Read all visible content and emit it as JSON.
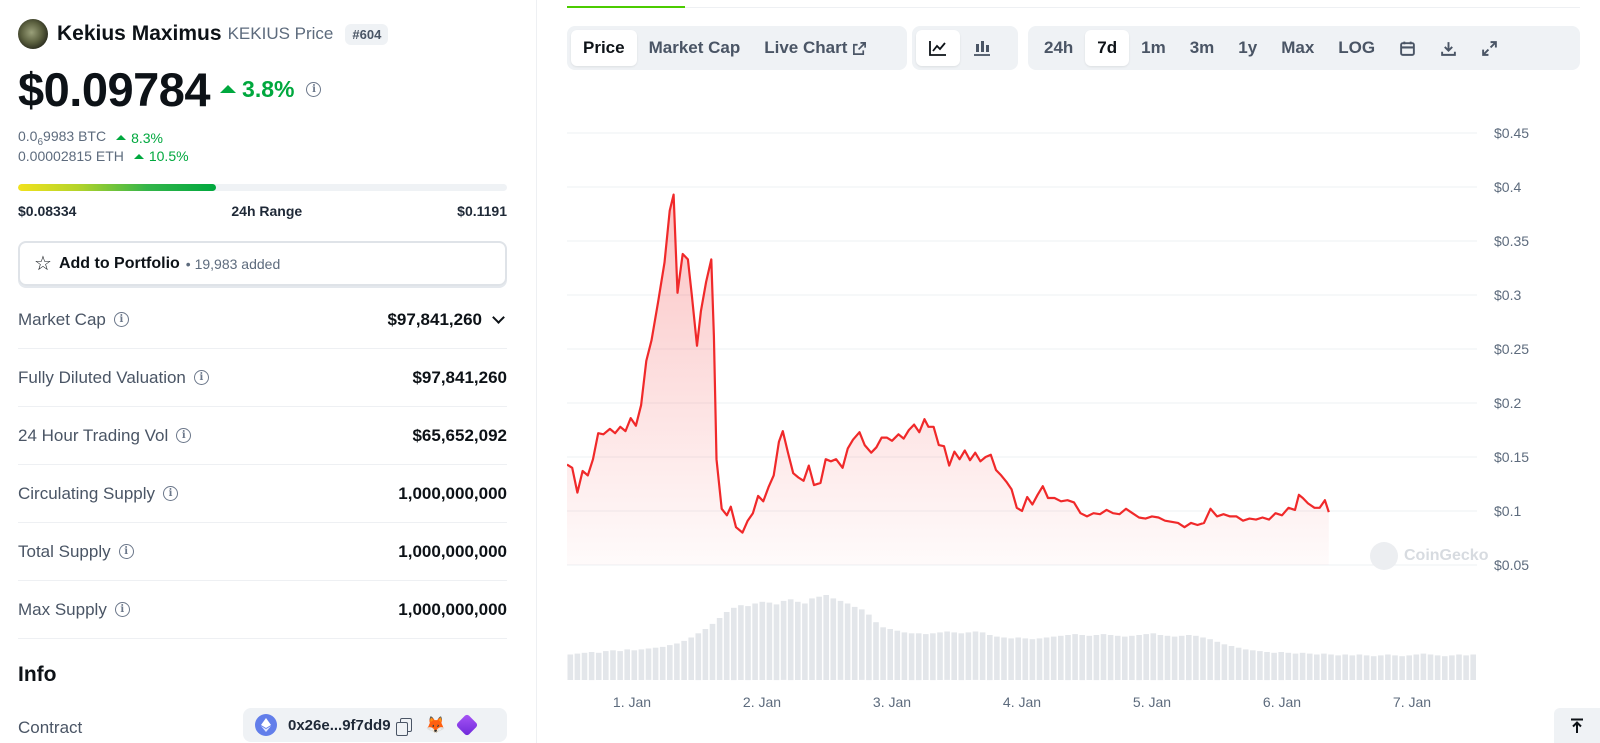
{
  "coin": {
    "name": "Kekius Maximus",
    "price_label": "KEKIUS Price",
    "rank": "#604",
    "price": "$0.09784",
    "change_24h": "3.8%"
  },
  "conversions": {
    "btc_prefix": "0.0",
    "btc_sub": "6",
    "btc_rest": "9983 BTC",
    "btc_change": "8.3%",
    "eth": "0.00002815 ETH",
    "eth_change": "10.5%"
  },
  "range": {
    "low": "$0.08334",
    "label": "24h Range",
    "high": "$0.1191",
    "current_fraction": 0.405
  },
  "portfolio": {
    "label": "Add to Portfolio",
    "added": "• 19,983 added"
  },
  "stats": [
    {
      "label": "Market Cap",
      "value": "$97,841,260"
    },
    {
      "label": "Fully Diluted Valuation",
      "value": "$97,841,260"
    },
    {
      "label": "24 Hour Trading Vol",
      "value": "$65,652,092"
    },
    {
      "label": "Circulating Supply",
      "value": "1,000,000,000"
    },
    {
      "label": "Total Supply",
      "value": "1,000,000,000"
    },
    {
      "label": "Max Supply",
      "value": "1,000,000,000"
    }
  ],
  "info": {
    "title": "Info",
    "contract_label": "Contract",
    "contract_address": "0x26e...9f7dd9"
  },
  "toolbar": {
    "view_tabs": [
      "Price",
      "Market Cap",
      "Live Chart"
    ],
    "active_view": "Price",
    "ranges": [
      "24h",
      "7d",
      "1m",
      "3m",
      "1y",
      "Max",
      "LOG"
    ],
    "active_range": "7d"
  },
  "watermark": "CoinGecko",
  "colors": {
    "up_green": "#00a83e",
    "line_red": "#f0292a",
    "tab_green": "#4bcc00"
  },
  "chart_data": {
    "type": "area",
    "x_ticks": [
      "1. Jan",
      "2. Jan",
      "3. Jan",
      "4. Jan",
      "5. Jan",
      "6. Jan",
      "7. Jan"
    ],
    "y_ticks": [
      "$0.45",
      "$0.4",
      "$0.35",
      "$0.3",
      "$0.25",
      "$0.2",
      "$0.15",
      "$0.1",
      "$0.05"
    ],
    "y_tick_values": [
      0.45,
      0.4,
      0.35,
      0.3,
      0.25,
      0.2,
      0.15,
      0.1,
      0.05
    ],
    "ylim": [
      0.05,
      0.45
    ],
    "xlim_days": [
      0.5,
      7.5
    ],
    "price_series": [
      [
        0.5,
        0.143
      ],
      [
        0.54,
        0.14
      ],
      [
        0.58,
        0.117
      ],
      [
        0.62,
        0.137
      ],
      [
        0.66,
        0.133
      ],
      [
        0.7,
        0.148
      ],
      [
        0.74,
        0.172
      ],
      [
        0.78,
        0.171
      ],
      [
        0.83,
        0.176
      ],
      [
        0.87,
        0.172
      ],
      [
        0.91,
        0.178
      ],
      [
        0.95,
        0.174
      ],
      [
        0.99,
        0.186
      ],
      [
        1.03,
        0.179
      ],
      [
        1.07,
        0.198
      ],
      [
        1.11,
        0.239
      ],
      [
        1.15,
        0.258
      ],
      [
        1.2,
        0.293
      ],
      [
        1.25,
        0.33
      ],
      [
        1.29,
        0.378
      ],
      [
        1.32,
        0.393
      ],
      [
        1.35,
        0.302
      ],
      [
        1.39,
        0.338
      ],
      [
        1.43,
        0.333
      ],
      [
        1.46,
        0.3
      ],
      [
        1.5,
        0.253
      ],
      [
        1.53,
        0.285
      ],
      [
        1.57,
        0.312
      ],
      [
        1.61,
        0.333
      ],
      [
        1.63,
        0.262
      ],
      [
        1.65,
        0.148
      ],
      [
        1.69,
        0.102
      ],
      [
        1.73,
        0.096
      ],
      [
        1.76,
        0.104
      ],
      [
        1.8,
        0.085
      ],
      [
        1.85,
        0.08
      ],
      [
        1.89,
        0.091
      ],
      [
        1.93,
        0.098
      ],
      [
        1.97,
        0.114
      ],
      [
        2.01,
        0.109
      ],
      [
        2.05,
        0.122
      ],
      [
        2.09,
        0.133
      ],
      [
        2.13,
        0.164
      ],
      [
        2.16,
        0.174
      ],
      [
        2.2,
        0.154
      ],
      [
        2.24,
        0.135
      ],
      [
        2.28,
        0.131
      ],
      [
        2.32,
        0.128
      ],
      [
        2.36,
        0.142
      ],
      [
        2.4,
        0.124
      ],
      [
        2.45,
        0.126
      ],
      [
        2.49,
        0.148
      ],
      [
        2.53,
        0.146
      ],
      [
        2.57,
        0.148
      ],
      [
        2.62,
        0.14
      ],
      [
        2.66,
        0.158
      ],
      [
        2.7,
        0.166
      ],
      [
        2.75,
        0.173
      ],
      [
        2.79,
        0.161
      ],
      [
        2.84,
        0.154
      ],
      [
        2.88,
        0.159
      ],
      [
        2.92,
        0.168
      ],
      [
        2.96,
        0.168
      ],
      [
        3.0,
        0.165
      ],
      [
        3.05,
        0.171
      ],
      [
        3.09,
        0.167
      ],
      [
        3.13,
        0.175
      ],
      [
        3.17,
        0.18
      ],
      [
        3.21,
        0.173
      ],
      [
        3.25,
        0.185
      ],
      [
        3.28,
        0.178
      ],
      [
        3.32,
        0.178
      ],
      [
        3.36,
        0.161
      ],
      [
        3.4,
        0.16
      ],
      [
        3.44,
        0.142
      ],
      [
        3.48,
        0.155
      ],
      [
        3.52,
        0.148
      ],
      [
        3.56,
        0.156
      ],
      [
        3.6,
        0.147
      ],
      [
        3.64,
        0.154
      ],
      [
        3.68,
        0.146
      ],
      [
        3.72,
        0.15
      ],
      [
        3.76,
        0.152
      ],
      [
        3.8,
        0.138
      ],
      [
        3.84,
        0.133
      ],
      [
        3.88,
        0.127
      ],
      [
        3.92,
        0.12
      ],
      [
        3.96,
        0.103
      ],
      [
        4.0,
        0.1
      ],
      [
        4.04,
        0.113
      ],
      [
        4.08,
        0.106
      ],
      [
        4.12,
        0.115
      ],
      [
        4.16,
        0.123
      ],
      [
        4.2,
        0.112
      ],
      [
        4.25,
        0.112
      ],
      [
        4.3,
        0.109
      ],
      [
        4.35,
        0.11
      ],
      [
        4.4,
        0.108
      ],
      [
        4.45,
        0.098
      ],
      [
        4.5,
        0.095
      ],
      [
        4.55,
        0.098
      ],
      [
        4.6,
        0.097
      ],
      [
        4.65,
        0.101
      ],
      [
        4.7,
        0.098
      ],
      [
        4.75,
        0.097
      ],
      [
        4.8,
        0.102
      ],
      [
        4.85,
        0.098
      ],
      [
        4.9,
        0.094
      ],
      [
        4.95,
        0.093
      ],
      [
        5.0,
        0.095
      ],
      [
        5.05,
        0.094
      ],
      [
        5.1,
        0.091
      ],
      [
        5.15,
        0.09
      ],
      [
        5.2,
        0.089
      ],
      [
        5.25,
        0.085
      ],
      [
        5.3,
        0.089
      ],
      [
        5.35,
        0.087
      ],
      [
        5.4,
        0.089
      ],
      [
        5.45,
        0.102
      ],
      [
        5.5,
        0.095
      ],
      [
        5.55,
        0.097
      ],
      [
        5.6,
        0.095
      ],
      [
        5.65,
        0.095
      ],
      [
        5.7,
        0.091
      ],
      [
        5.75,
        0.093
      ],
      [
        5.8,
        0.092
      ],
      [
        5.85,
        0.094
      ],
      [
        5.9,
        0.092
      ],
      [
        5.95,
        0.098
      ],
      [
        6.0,
        0.096
      ],
      [
        6.05,
        0.103
      ],
      [
        6.1,
        0.101
      ],
      [
        6.13,
        0.115
      ],
      [
        6.16,
        0.112
      ],
      [
        6.2,
        0.107
      ],
      [
        6.25,
        0.103
      ],
      [
        6.29,
        0.103
      ],
      [
        6.33,
        0.11
      ],
      [
        6.36,
        0.099
      ]
    ],
    "volume_relative": [
      0.3,
      0.31,
      0.32,
      0.33,
      0.32,
      0.34,
      0.35,
      0.34,
      0.36,
      0.35,
      0.36,
      0.37,
      0.38,
      0.39,
      0.41,
      0.43,
      0.46,
      0.5,
      0.55,
      0.6,
      0.66,
      0.73,
      0.8,
      0.85,
      0.88,
      0.87,
      0.9,
      0.92,
      0.91,
      0.89,
      0.93,
      0.95,
      0.92,
      0.9,
      0.96,
      0.98,
      1.0,
      0.96,
      0.93,
      0.9,
      0.86,
      0.83,
      0.77,
      0.68,
      0.62,
      0.6,
      0.58,
      0.56,
      0.55,
      0.55,
      0.54,
      0.55,
      0.56,
      0.57,
      0.56,
      0.55,
      0.56,
      0.57,
      0.56,
      0.53,
      0.51,
      0.5,
      0.49,
      0.5,
      0.49,
      0.48,
      0.49,
      0.5,
      0.51,
      0.52,
      0.53,
      0.54,
      0.53,
      0.52,
      0.53,
      0.54,
      0.53,
      0.52,
      0.51,
      0.52,
      0.53,
      0.54,
      0.55,
      0.53,
      0.52,
      0.51,
      0.52,
      0.53,
      0.52,
      0.5,
      0.48,
      0.45,
      0.42,
      0.4,
      0.38,
      0.36,
      0.35,
      0.34,
      0.33,
      0.32,
      0.33,
      0.32,
      0.31,
      0.32,
      0.31,
      0.3,
      0.31,
      0.3,
      0.29,
      0.3,
      0.29,
      0.3,
      0.29,
      0.28,
      0.29,
      0.3,
      0.29,
      0.28,
      0.29,
      0.3,
      0.31,
      0.3,
      0.29,
      0.28,
      0.29,
      0.3,
      0.29,
      0.3
    ],
    "grid": true
  }
}
